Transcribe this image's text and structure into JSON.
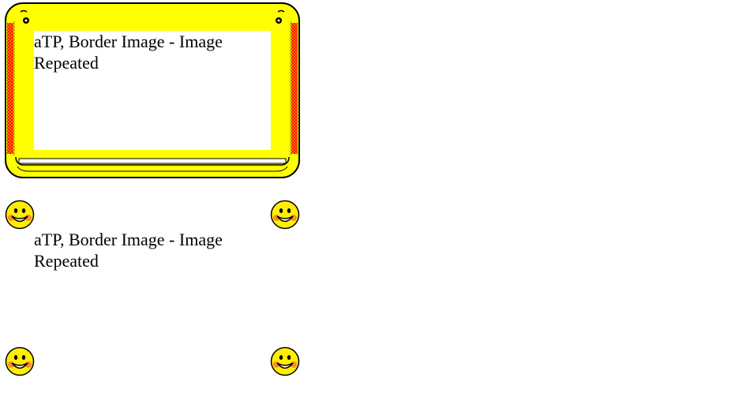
{
  "boxes": [
    {
      "text": "aTP, Border Image - Image Repeated",
      "border_style": "yellow-frame",
      "icons": [
        "frame-corner-bolt-icon"
      ]
    },
    {
      "text": "aTP, Border Image - Image Repeated",
      "border_style": "smiley-corners",
      "icons": [
        "smiley-face-icon"
      ]
    }
  ],
  "colors": {
    "frame_yellow": "#ffff00",
    "frame_outline": "#000000",
    "frame_side_orange": "#ff8000",
    "frame_side_red": "#ff0000",
    "smiley_yellow": "#ffee00",
    "smiley_cheek": "#ff8a2a"
  }
}
